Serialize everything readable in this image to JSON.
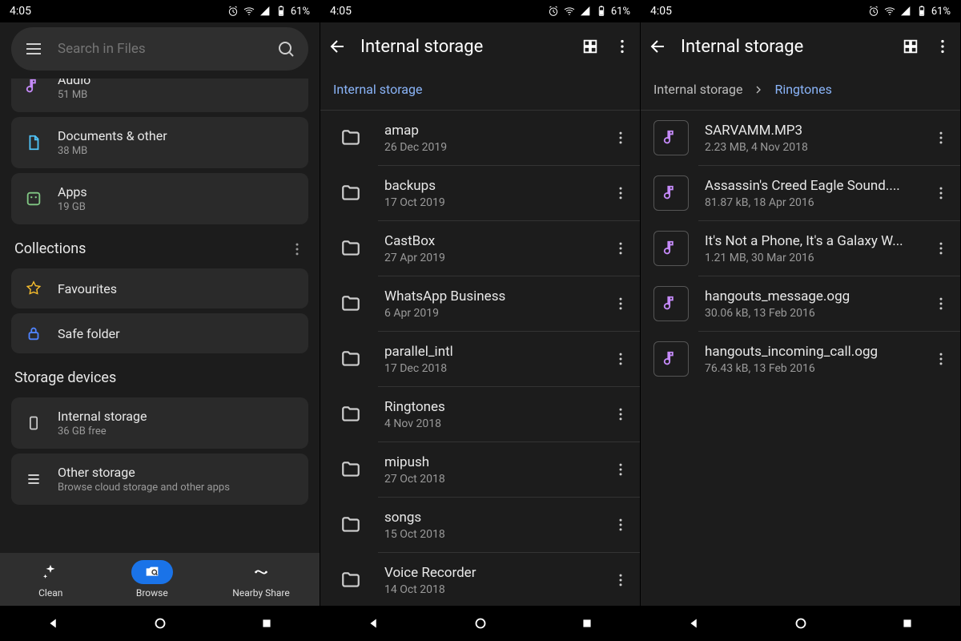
{
  "status": {
    "time": "4:05",
    "battery": "61%"
  },
  "screen1": {
    "search_placeholder": "Search in Files",
    "categories": [
      {
        "icon": "audio",
        "title": "Audio",
        "sub": "51 MB"
      },
      {
        "icon": "doc",
        "title": "Documents & other",
        "sub": "38 MB"
      },
      {
        "icon": "app",
        "title": "Apps",
        "sub": "19 GB"
      }
    ],
    "collections_label": "Collections",
    "collections": [
      {
        "icon": "star",
        "title": "Favourites"
      },
      {
        "icon": "lock",
        "title": "Safe folder"
      }
    ],
    "storage_label": "Storage devices",
    "storage": [
      {
        "icon": "phone",
        "title": "Internal storage",
        "sub": "36 GB free"
      },
      {
        "icon": "list",
        "title": "Other storage",
        "sub": "Browse cloud storage and other apps"
      }
    ],
    "nav": {
      "clean": "Clean",
      "browse": "Browse",
      "share": "Nearby Share"
    }
  },
  "screen2": {
    "title": "Internal storage",
    "crumb": "Internal storage",
    "folders": [
      {
        "name": "amap",
        "date": "26 Dec 2019"
      },
      {
        "name": "backups",
        "date": "17 Oct 2019"
      },
      {
        "name": "CastBox",
        "date": "27 Apr 2019"
      },
      {
        "name": "WhatsApp Business",
        "date": "6 Apr 2019"
      },
      {
        "name": "parallel_intl",
        "date": "17 Dec 2018"
      },
      {
        "name": "Ringtones",
        "date": "4 Nov 2018"
      },
      {
        "name": "mipush",
        "date": "27 Oct 2018"
      },
      {
        "name": "songs",
        "date": "15 Oct 2018"
      },
      {
        "name": "Voice Recorder",
        "date": "14 Oct 2018"
      }
    ]
  },
  "screen3": {
    "title": "Internal storage",
    "crumb1": "Internal storage",
    "crumb2": "Ringtones",
    "files": [
      {
        "name": "SARVAMM.MP3",
        "meta": "2.23 MB, 4 Nov 2018"
      },
      {
        "name": "Assassin's Creed Eagle Sound....",
        "meta": "81.87 kB, 18 Apr 2016"
      },
      {
        "name": "It's Not a Phone, It's a Galaxy  W...",
        "meta": "1.21 MB, 30 Mar 2016"
      },
      {
        "name": "hangouts_message.ogg",
        "meta": "30.06 kB, 13 Feb 2016"
      },
      {
        "name": "hangouts_incoming_call.ogg",
        "meta": "76.43 kB, 13 Feb 2016"
      }
    ]
  }
}
